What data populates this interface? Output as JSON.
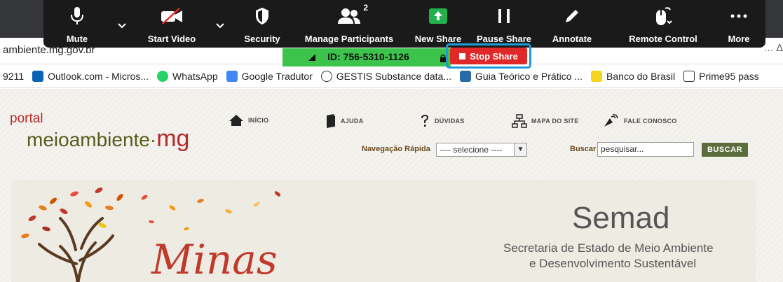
{
  "browser": {
    "address": "ambiente.mg.gov.br",
    "address_right_glyph": "… ᐃ",
    "bookmarks": [
      {
        "label": "9211",
        "color": ""
      },
      {
        "label": "Outlook.com - Micros...",
        "color": "#0a64b4"
      },
      {
        "label": "WhatsApp",
        "color": "#25d366"
      },
      {
        "label": "Google Tradutor",
        "color": "#4285f4"
      },
      {
        "label": "GESTIS Substance data...",
        "color": "#333333"
      },
      {
        "label": "Guia Teórico e Prático ...",
        "color": "#2a6aa8"
      },
      {
        "label": "Banco do Brasil",
        "color": "#f6d31c"
      },
      {
        "label": "Prime95 pass",
        "color": "#333333"
      }
    ]
  },
  "zoom_toolbar": {
    "mute": {
      "label": "Mute",
      "icon": "microphone-icon"
    },
    "start_video": {
      "label": "Start Video",
      "icon": "video-off-icon"
    },
    "security": {
      "label": "Security",
      "icon": "shield-icon"
    },
    "participants": {
      "label": "Manage Participants",
      "count": "2",
      "icon": "participants-icon"
    },
    "new_share": {
      "label": "New Share",
      "icon": "share-arrow-icon",
      "color": "#23b14d"
    },
    "pause_share": {
      "label": "Pause Share",
      "icon": "pause-icon"
    },
    "annotate": {
      "label": "Annotate",
      "icon": "pen-icon"
    },
    "remote_control": {
      "label": "Remote Control",
      "icon": "mouse-icon"
    },
    "more": {
      "label": "More",
      "icon": "ellipsis-icon"
    }
  },
  "share_strip": {
    "meeting_id": "ID: 756-5310-1126",
    "stop_share_label": "Stop Share",
    "strip_color": "#3bc34c",
    "stop_color": "#e02828",
    "highlight_color": "#1e9bd7"
  },
  "site": {
    "logo_small": "portal",
    "logo_main": "meioambiente",
    "logo_dot": "·",
    "logo_accent": "mg",
    "nav": [
      {
        "label": "INÍCIO",
        "icon": "home-icon"
      },
      {
        "label": "AJUDA",
        "icon": "book-icon"
      },
      {
        "label": "DÚVIDAS",
        "icon": "question-icon"
      },
      {
        "label": "MAPA DO SITE",
        "icon": "sitemap-icon"
      },
      {
        "label": "FALE CONOSCO",
        "icon": "contact-icon"
      }
    ],
    "quick_nav_label": "Navegação Rápida",
    "quick_nav_value": "---- selecione ----",
    "search_label": "Buscar",
    "search_placeholder": "pesquisar...",
    "search_button": "BUSCAR",
    "banner": {
      "script_text": "Minas",
      "title": "Semad",
      "subtitle_line1": "Secretaria de Estado de Meio Ambiente",
      "subtitle_line2": "e Desenvolvimento Sustentável"
    }
  }
}
